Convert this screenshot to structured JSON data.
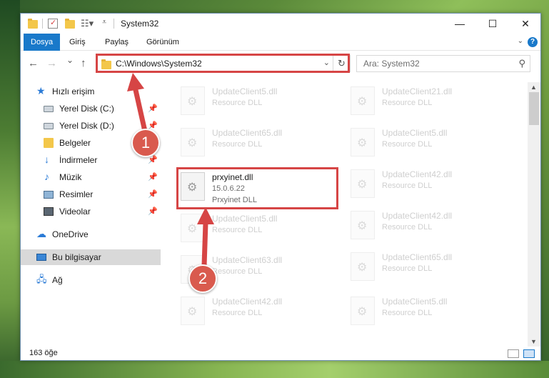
{
  "window": {
    "title": "System32",
    "min": "—",
    "max": "☐",
    "close": "✕"
  },
  "ribbon": {
    "tabs": [
      {
        "label": "Dosya",
        "active": true
      },
      {
        "label": "Giriş"
      },
      {
        "label": "Paylaş"
      },
      {
        "label": "Görünüm"
      }
    ],
    "help": "?"
  },
  "navbar": {
    "back": "←",
    "forward": "→",
    "recent": "⌄",
    "up": "↑",
    "address": "C:\\Windows\\System32",
    "address_dropdown": "⌄",
    "refresh": "↻",
    "search_placeholder": "Ara: System32"
  },
  "sidebar": {
    "items": [
      {
        "label": "Hızlı erişim"
      },
      {
        "label": "Yerel Disk (C:)",
        "pinned": true
      },
      {
        "label": "Yerel Disk (D:)",
        "pinned": true
      },
      {
        "label": "Belgeler",
        "pinned": true
      },
      {
        "label": "İndirmeler",
        "pinned": true
      },
      {
        "label": "Müzik",
        "pinned": true
      },
      {
        "label": "Resimler",
        "pinned": true
      },
      {
        "label": "Videolar",
        "pinned": true
      },
      {
        "label": "OneDrive"
      },
      {
        "label": "Bu bilgisayar",
        "selected": true
      },
      {
        "label": "Ağ"
      }
    ],
    "pin_glyph": "📌"
  },
  "files": {
    "main": {
      "name": "prxyinet.dll",
      "version": "15.0.6.22",
      "description": "Prxyinet DLL"
    },
    "left_col": [
      {
        "name": "UpdateClient5.dll",
        "desc": "Resource DLL"
      },
      {
        "name": "UpdateClient65.dll",
        "desc": "Resource DLL"
      },
      {
        "name": "UpdateClient5.dll",
        "desc": "Resource DLL"
      },
      {
        "name": "UpdateClient63.dll",
        "desc": "Resource DLL"
      },
      {
        "name": "UpdateClient42.dll",
        "desc": "Resource DLL"
      }
    ],
    "right_col": [
      {
        "name": "UpdateClient21.dll",
        "desc": "Resource DLL"
      },
      {
        "name": "UpdateClient5.dll",
        "desc": "Resource DLL"
      },
      {
        "name": "UpdateClient42.dll",
        "desc": "Resource DLL"
      },
      {
        "name": "UpdateClient42.dll",
        "desc": "Resource DLL"
      },
      {
        "name": "UpdateClient65.dll",
        "desc": "Resource DLL"
      },
      {
        "name": "UpdateClient5.dll",
        "desc": "Resource DLL"
      }
    ]
  },
  "status": {
    "count": "163 öğe"
  },
  "annotations": {
    "badge1": "1",
    "badge2": "2",
    "color": "#d64545"
  }
}
